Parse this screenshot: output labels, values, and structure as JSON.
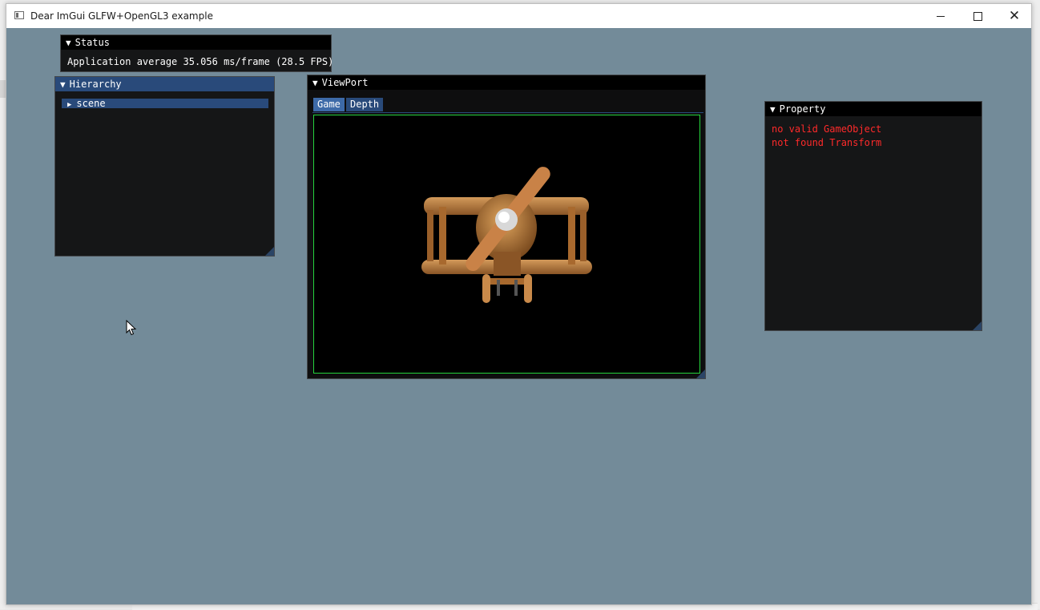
{
  "window": {
    "title": "Dear ImGui GLFW+OpenGL3 example"
  },
  "status": {
    "title": "Status",
    "line": "Application average 35.056 ms/frame (28.5 FPS)"
  },
  "hierarchy": {
    "title": "Hierarchy",
    "items": [
      {
        "label": "scene"
      }
    ]
  },
  "viewport": {
    "title": "ViewPort",
    "tabs": [
      {
        "label": "Game",
        "selected": true
      },
      {
        "label": "Depth",
        "selected": false
      }
    ],
    "render": "toy wooden biplane"
  },
  "property": {
    "title": "Property",
    "errors": [
      "no valid GameObject",
      "not found Transform"
    ]
  },
  "colors": {
    "background": "#738b99",
    "title_active": "#294a7a",
    "error_text": "#ff2a2a",
    "viewport_border": "#25d33c"
  },
  "icons": {
    "tree_toggle": "triangle-right-icon",
    "collapse": "triangle-down-icon"
  }
}
